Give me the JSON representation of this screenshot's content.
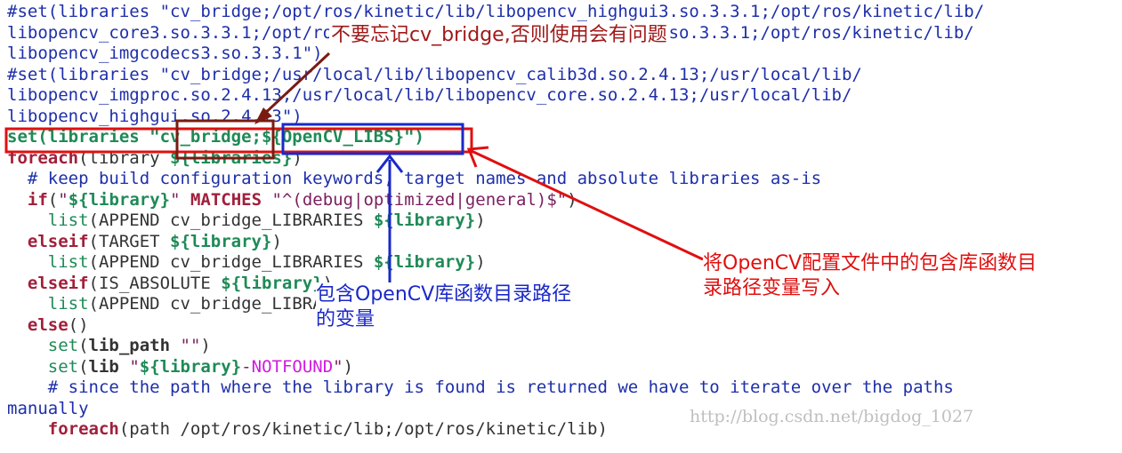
{
  "code_lines": [
    "#set(libraries \"cv_bridge;/opt/ros/kinetic/lib/libopencv_highgui3.so.3.3.1;/opt/ros/kinetic/lib/",
    "libopencv_core3.so.3.3.1;/opt/ros/kinetic/lib/libopencv_imgproc3.so.3.3.1;/opt/ros/kinetic/lib/",
    "libopencv_imgcodecs3.so.3.3.1\")",
    "#set(libraries \"cv_bridge;/usr/local/lib/libopencv_calib3d.so.2.4.13;/usr/local/lib/",
    "libopencv_imgproc.so.2.4.13;/usr/local/lib/libopencv_core.so.2.4.13;/usr/local/lib/",
    "libopencv_highgui.so.2.4.13\")",
    "set(libraries \"cv_bridge;${OpenCV_LIBS}\")",
    "foreach(library ${libraries})",
    "  # keep build configuration keywords, target names and absolute libraries as-is",
    "  if(\"${library}\" MATCHES \"^(debug|optimized|general)$\")",
    "    list(APPEND cv_bridge_LIBRARIES ${library})",
    "  elseif(TARGET ${library})",
    "    list(APPEND cv_bridge_LIBRARIES ${library})",
    "  elseif(IS_ABSOLUTE ${library})",
    "    list(APPEND cv_bridge_LIBRARIES ${library})",
    "  else()",
    "    set(lib_path \"\")",
    "    set(lib \"${library}-NOTFOUND\")",
    "    # since the path where the library is found is returned we have to iterate over the paths",
    "manually",
    "    foreach(path /opt/ros/kinetic/lib;/opt/ros/kinetic/lib)"
  ],
  "annotations": {
    "cv_bridge_note": "不要忘记cv_bridge,否则使用会有问题",
    "opencv_libs_note": "包含OpenCV库函数目录路径\n的变量",
    "config_note": "将OpenCV配置文件中的包含库函数目\n录路径变量写入"
  },
  "watermark": "http://blog.csdn.net/bigdog_1027",
  "colors": {
    "code_text": "#333333",
    "comment": "#1e2faa",
    "keyword": "#a0203b",
    "function": "#1f8a57",
    "string": "#7a1f5e",
    "notfound": "#d01adf",
    "red_box": "#e00f0f",
    "dark_red_box": "#7a1b12",
    "blue_box": "#1a28c8"
  }
}
